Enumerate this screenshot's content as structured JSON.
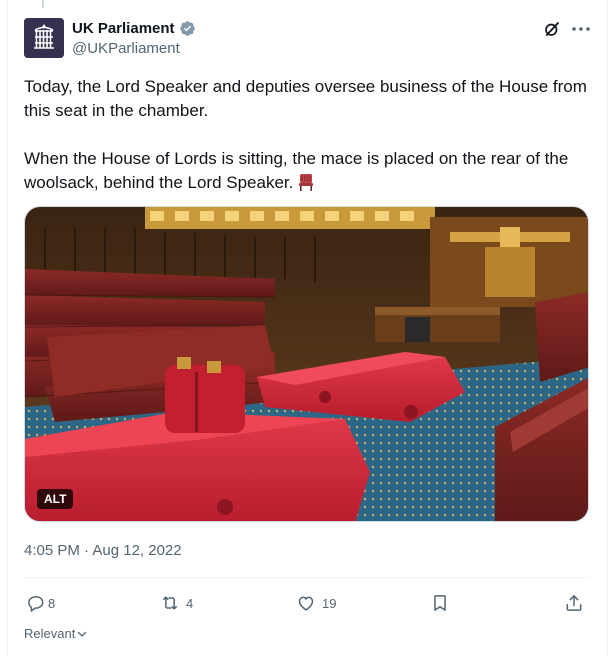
{
  "author": {
    "display_name": "UK Parliament",
    "handle": "@UKParliament",
    "verified": true
  },
  "tweet": {
    "paragraph1": "Today, the Lord Speaker and deputies oversee business of the House from this seat in the chamber.",
    "paragraph2": "When the House of Lords is sitting, the mace is placed on the rear of the woolsack, behind the Lord Speaker.",
    "emoji": "chair-emoji"
  },
  "media": {
    "alt_label": "ALT"
  },
  "meta": {
    "timestamp": "4:05 PM · Aug 12, 2022"
  },
  "actions": {
    "replies": "8",
    "reposts": "4",
    "likes": "19"
  },
  "footer": {
    "relevant_label": "Relevant"
  },
  "colors": {
    "text_primary": "#0f1419",
    "text_secondary": "#536471",
    "verified": "#829aab",
    "divider": "#eff3f4"
  }
}
